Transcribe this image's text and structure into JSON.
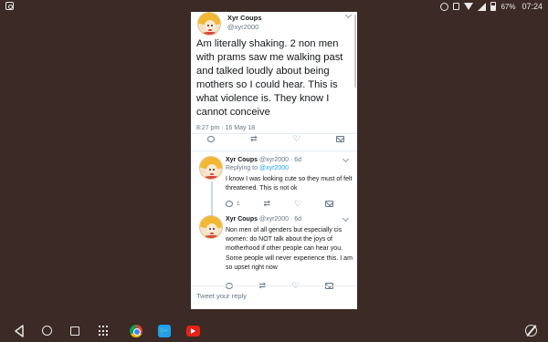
{
  "status_bar": {
    "battery": "67%",
    "time": "07:24"
  },
  "main_tweet": {
    "name": "Xyr Coups",
    "handle": "@xyr2000",
    "text": "Am literally shaking. 2 non men with prams saw me walking past and talked loudly about being mothers so I could hear. This is what violence is. They know I cannot conceive",
    "timestamp": "8:27 pm · 16 May 18"
  },
  "replies": [
    {
      "name": "Xyr Coups",
      "handle": "@xyr2000",
      "age": "· 6d",
      "replying_prefix": "Replying to ",
      "replying_to": "@xyr2000",
      "text": "I know I was looking cute so they must of felt threatened. This is not ok",
      "reply_count": "1"
    },
    {
      "name": "Xyr Coups",
      "handle": "@xyr2000",
      "age": "· 6d",
      "text": "Non men of all genders but especially cis women: do NOT talk about the joys of motherhood if other people can hear you. Some people will never experience this. I am so upset right now"
    }
  ],
  "reply_input": {
    "placeholder": "Tweet your reply"
  },
  "icons": {
    "reply": "reply-icon",
    "retweet": "retweet-icon",
    "like": "heart-icon",
    "dm": "mail-icon"
  }
}
